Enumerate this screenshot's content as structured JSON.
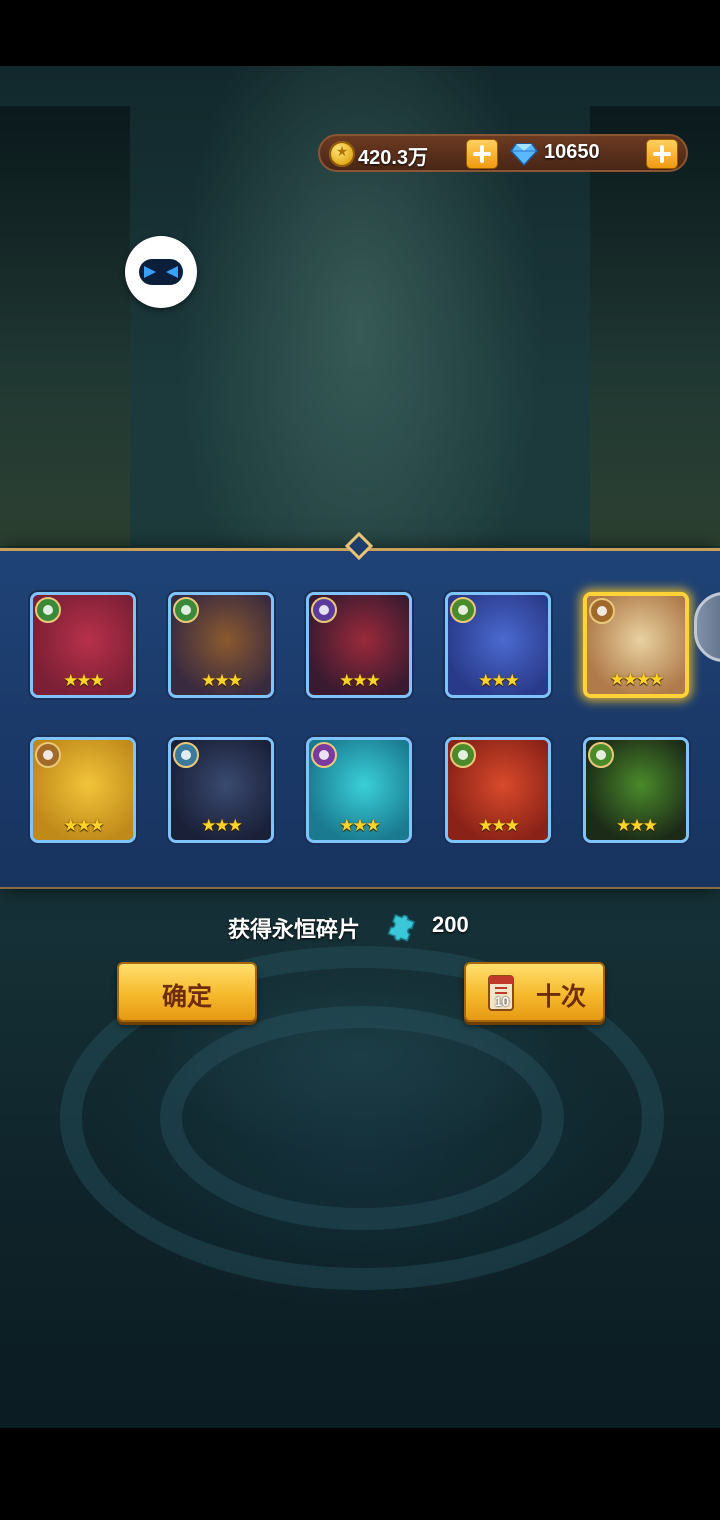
{
  "currency": {
    "gold": {
      "value": "420.3万",
      "icon": "gold-coin-icon"
    },
    "gems": {
      "value": "10650",
      "icon": "diamond-icon"
    }
  },
  "heroes": [
    {
      "name": "hero-red-bird",
      "faction": "nature",
      "faction_color": "#3a8a3a",
      "stars": 3,
      "highlight": false,
      "colors": [
        "#b8304a",
        "#7a1f35"
      ]
    },
    {
      "name": "hero-monkey-warrior",
      "faction": "nature",
      "faction_color": "#3a8a3a",
      "stars": 3,
      "highlight": false,
      "colors": [
        "#8a5a2e",
        "#3a2a40"
      ]
    },
    {
      "name": "hero-eagle-knight",
      "faction": "dark",
      "faction_color": "#5a3a9a",
      "stars": 3,
      "highlight": false,
      "colors": [
        "#9a2a3a",
        "#3a1a30"
      ]
    },
    {
      "name": "hero-blue-shark",
      "faction": "forest",
      "faction_color": "#4a8a2a",
      "stars": 3,
      "highlight": false,
      "colors": [
        "#4a6ad0",
        "#2a3a8a"
      ]
    },
    {
      "name": "hero-elf-maiden",
      "faction": "light",
      "faction_color": "#a06a2a",
      "stars": 4,
      "highlight": true,
      "colors": [
        "#e8d2a0",
        "#b07a4a"
      ]
    },
    {
      "name": "hero-golden-golem",
      "faction": "light",
      "faction_color": "#a06a2a",
      "stars": 3,
      "highlight": false,
      "colors": [
        "#f2c43a",
        "#c08a1a"
      ]
    },
    {
      "name": "hero-dark-valkyrie",
      "faction": "water",
      "faction_color": "#3a7a9a",
      "stars": 3,
      "highlight": false,
      "colors": [
        "#3a4a70",
        "#1a2038"
      ]
    },
    {
      "name": "hero-ice-beast",
      "faction": "arcane",
      "faction_color": "#7a3aa0",
      "stars": 3,
      "highlight": false,
      "colors": [
        "#3ad0d8",
        "#1a7a90"
      ]
    },
    {
      "name": "hero-red-ogre",
      "faction": "forest",
      "faction_color": "#4a8a2a",
      "stars": 3,
      "highlight": false,
      "colors": [
        "#d84a2a",
        "#8a2218"
      ]
    },
    {
      "name": "hero-rock-golem",
      "faction": "forest",
      "faction_color": "#4a8a2a",
      "stars": 3,
      "highlight": false,
      "colors": [
        "#4a8a2a",
        "#1c2a18"
      ]
    }
  ],
  "reward": {
    "label": "获得永恒碎片",
    "icon": "puzzle-shard-icon",
    "amount": "200"
  },
  "buttons": {
    "confirm": "确定",
    "ten_draw": "十次",
    "ticket_count": "10"
  }
}
